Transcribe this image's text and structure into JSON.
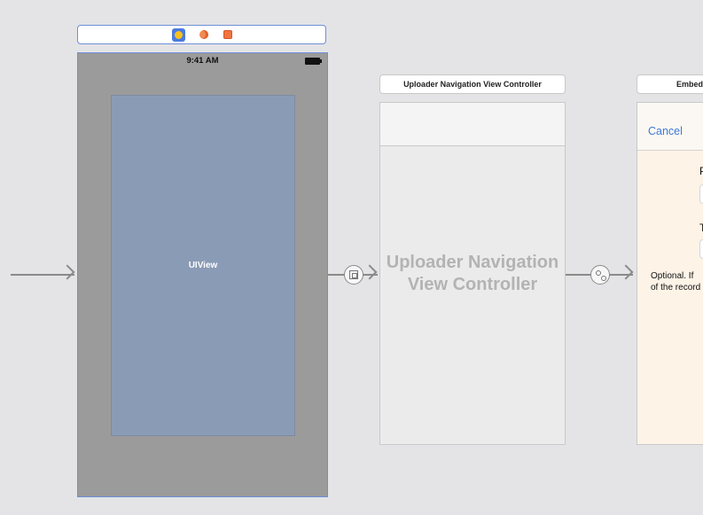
{
  "first_scene": {
    "dock_icons": [
      "view-controller-icon",
      "first-responder-icon",
      "exit-icon"
    ],
    "status_time": "9:41 AM",
    "view_label": "UIView"
  },
  "navigation_scene": {
    "title": "Uploader Navigation View Controller",
    "placeholder_line1": "Uploader Navigation",
    "placeholder_line2": "View Controller"
  },
  "embed_scene": {
    "title": "Embed",
    "cancel_label": "Cancel",
    "label_p": "P",
    "label_t": "T",
    "note_line1": "Optional.  If",
    "note_line2": "of the record"
  },
  "colors": {
    "canvas": "#e4e4e6",
    "selection": "#6f8fd8",
    "uiview": "#8a9bb6",
    "cancel": "#3d79d9"
  }
}
